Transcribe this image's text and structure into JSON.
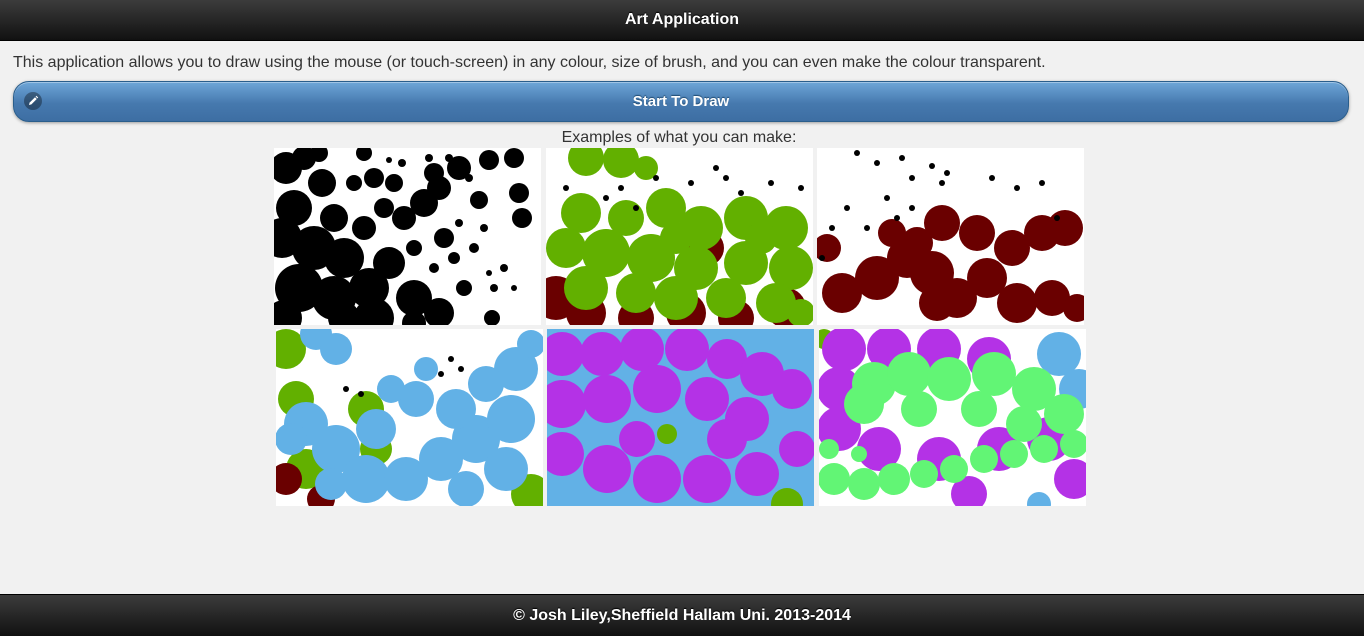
{
  "header": {
    "title": "Art Application"
  },
  "intro_text": "This application allows you to draw using the mouse (or touch-screen) in any colour, size of brush, and you can even make the colour transparent.",
  "start_button": {
    "label": "Start To Draw",
    "icon": "pencil-icon",
    "color": "#4679ae"
  },
  "examples": {
    "label": "Examples of what you can make:",
    "images": [
      {
        "colors": [
          "#000000"
        ]
      },
      {
        "colors": [
          "#6a0000",
          "#62b000"
        ]
      },
      {
        "colors": [
          "#6a0000"
        ]
      },
      {
        "colors": [
          "#62b000",
          "#6a0000",
          "#62b1e6"
        ]
      },
      {
        "colors": [
          "#62b1e6",
          "#b432e6",
          "#62b000"
        ]
      },
      {
        "colors": [
          "#b432e6",
          "#62b1e6",
          "#62f575"
        ]
      }
    ]
  },
  "footer": {
    "text": "© Josh Liley,Sheffield Hallam Uni. 2013-2014"
  }
}
